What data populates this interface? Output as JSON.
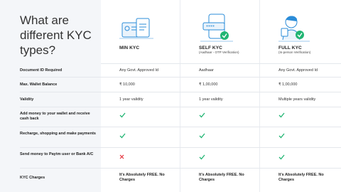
{
  "title": "What are different KYC types?",
  "columns": [
    {
      "title": "MIN KYC",
      "subtitle": ""
    },
    {
      "title": "SELF KYC",
      "subtitle": "(Aadhaar - OTP Verification)"
    },
    {
      "title": "FULL KYC",
      "subtitle": "(In-person Verification)"
    }
  ],
  "rows": [
    {
      "label": "Document ID Required",
      "values": [
        "Any Govt. Approved Id",
        "Aadhaar",
        "Any Govt. Approved Id"
      ]
    },
    {
      "label": "Max. Wallet Balance",
      "values": [
        "₹ 10,000",
        "₹ 1,00,000",
        "₹ 1,00,000"
      ]
    },
    {
      "label": "Validity",
      "values": [
        "1 year validity",
        "1 year validity",
        "Multiple years validity"
      ]
    },
    {
      "label": "Add money to your wallet and receive cash back",
      "values": [
        "check",
        "check",
        "check"
      ]
    },
    {
      "label": "Recharge, shopping and make payments",
      "values": [
        "check",
        "check",
        "check"
      ]
    },
    {
      "label": "Send money to Paytm user or Bank A/C",
      "values": [
        "cross",
        "check",
        "check"
      ]
    },
    {
      "label": "KYC Charges",
      "values": [
        "It's Absolutely FREE. No Charges",
        "It's Absolutely FREE. No Charges",
        "It's Absolutely FREE. No Charges"
      ]
    }
  ],
  "colors": {
    "check": "#21b573",
    "cross": "#e5333b",
    "accent": "#2b8cd8"
  }
}
